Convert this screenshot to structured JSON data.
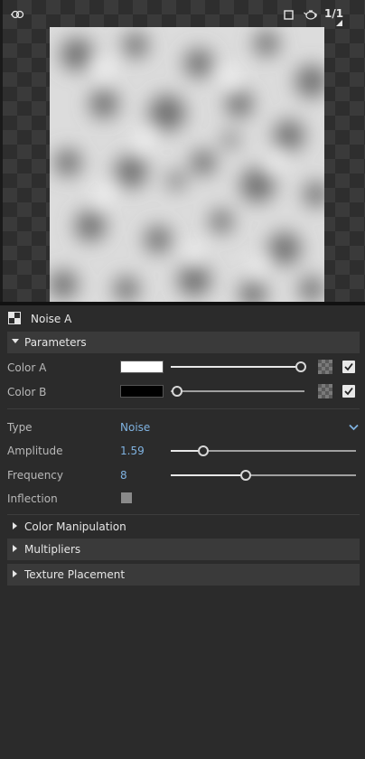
{
  "preview": {
    "ratio_label": "1/1",
    "icons": [
      "link-icon",
      "frame-icon",
      "teapot-icon"
    ]
  },
  "node": {
    "title": "Noise A",
    "icon": "node-icon"
  },
  "sections": {
    "parameters": "Parameters",
    "color_manipulation": "Color Manipulation",
    "multipliers": "Multipliers",
    "texture_placement": "Texture Placement"
  },
  "params": {
    "color_a": {
      "label": "Color A",
      "color": "#ffffff",
      "slider_fraction": 1.0,
      "enabled": true
    },
    "color_b": {
      "label": "Color B",
      "color": "#000000",
      "slider_fraction": 0.0,
      "enabled": true
    },
    "type": {
      "label": "Type",
      "value": "Noise"
    },
    "amplitude": {
      "label": "Amplitude",
      "value": "1.59",
      "slider_fraction": 0.17
    },
    "frequency": {
      "label": "Frequency",
      "value": "8",
      "slider_fraction": 0.4
    },
    "inflection": {
      "label": "Inflection",
      "checked": false
    }
  },
  "colors": {
    "accent": "#7fb2e0",
    "panel": "#2b2b2b",
    "section": "#3a3a3a"
  }
}
